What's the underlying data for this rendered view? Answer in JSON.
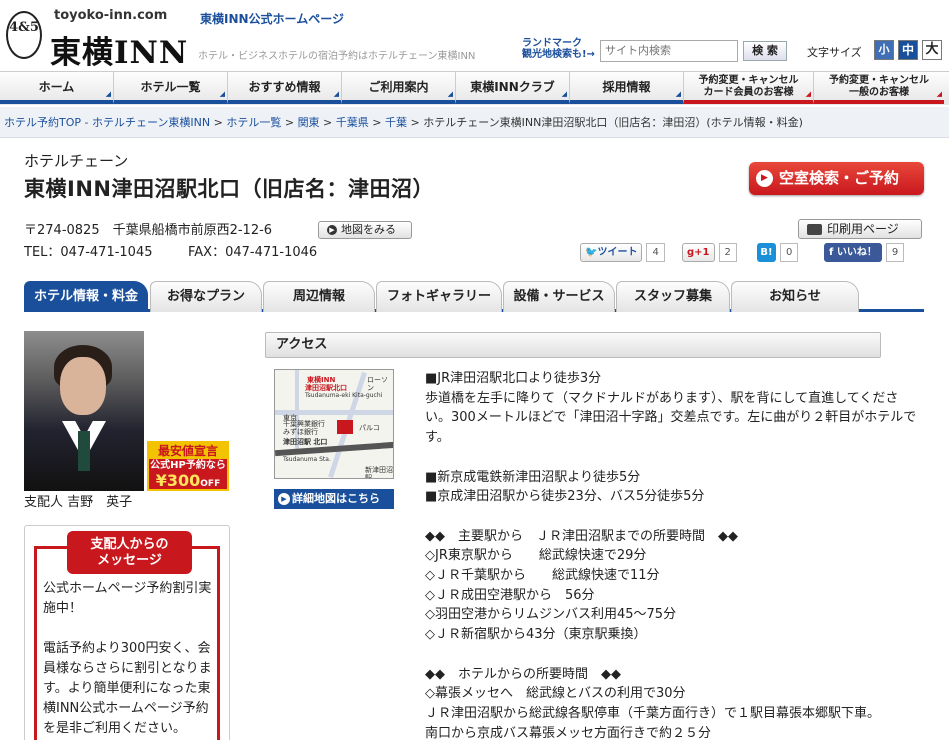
{
  "header": {
    "emblem": "4&5",
    "site_url": "toyoko-inn.com",
    "logo_name": "東横INN",
    "official_link": "東横INN公式ホームページ",
    "tagline": "ホテル・ビジネスホテルの宿泊予約はホテルチェーン東横INN",
    "landmark_line1": "ランドマーク",
    "landmark_line2": "観光地検索も!→",
    "search_placeholder": "サイト内検索",
    "search_button": "検 索",
    "font_size_label": "文字サイズ",
    "font_small": "小",
    "font_medium": "中",
    "font_large": "大"
  },
  "nav": {
    "items": [
      "ホーム",
      "ホテル一覧",
      "おすすめ情報",
      "ご利用案内",
      "東横INNクラブ",
      "採用情報"
    ],
    "member_change_line1": "予約変更・キャンセル",
    "member_change_line2": "カード会員のお客様",
    "general_change_line1": "予約変更・キャンセル",
    "general_change_line2": "一般のお客様",
    "arrow": "◢"
  },
  "breadcrumb": {
    "items": [
      "ホテル予約TOP - ホテルチェーン東横INN",
      "ホテル一覧",
      "関東",
      "千葉県",
      "千葉"
    ],
    "separator": " > ",
    "current": "ホテルチェーン東横INN津田沼駅北口（旧店名：津田沼）(ホテル情報・料金)"
  },
  "hotel": {
    "chain": "ホテルチェーン",
    "name": "東横INN津田沼駅北口（旧店名：津田沼）",
    "reserve_button": "空室検索・ご予約",
    "address": "〒274-0825　千葉県船橋市前原西2-12-6",
    "map_button": "地図をみる",
    "tel": "TEL：047-471-1045",
    "fax": "FAX：047-471-1046",
    "print_button": "印刷用ページ"
  },
  "social": {
    "tweet_label": "ツイート",
    "tweet_count": "4",
    "gplus_label": "g+1",
    "gplus_count": "2",
    "hatena_label": "B!",
    "hatena_count": "0",
    "like_label": "f いいね！",
    "like_count": "9"
  },
  "tabs": [
    "ホテル情報・料金",
    "お得なプラン",
    "周辺情報",
    "フォトギャラリー",
    "設備・サービス",
    "スタッフ募集",
    "お知らせ"
  ],
  "manager": {
    "name": "支配人 吉野　英子",
    "badge_line1": "最安値宣言",
    "badge_line2": "公式HP予約なら",
    "badge_line3": "¥300",
    "badge_line3_suffix": "OFF"
  },
  "message": {
    "title_line1": "支配人からの",
    "title_line2": "メッセージ",
    "paragraph1": "公式ホームページ予約割引実施中！",
    "paragraph2": "電話予約より300円安く、会員様ならさらに割引となります。より簡単便利になった東横INN公式ホームページ予約を是非ご利用ください。"
  },
  "access": {
    "heading": "アクセス",
    "map_detail_button": "詳細地図はこちら",
    "map_labels": {
      "l1": "東横INN",
      "l2": "津田沼駅北口",
      "l3": "Tsudanuma-eki Kita-guchi",
      "l4": "ローソン",
      "l5": "千葉興業銀行",
      "l6": "パルコ",
      "l7": "津田沼駅 北口",
      "l8": "Tsudanuma Sta.",
      "l9": "新津田沼駅",
      "l10": "みずほ銀行",
      "l11": "東京"
    },
    "lines": [
      "■JR津田沼駅北口より徒歩3分",
      "歩道橋を左手に降りて（マクドナルドがあります）、駅を背にして直進してください。300メートルほどで「津田沼十字路」交差点です。左に曲がり２軒目がホテルです。",
      "",
      "■新京成電鉄新津田沼駅より徒歩5分",
      "■京成津田沼駅から徒歩23分、バス5分徒歩5分",
      "",
      "◆◆　主要駅から　ＪＲ津田沼駅までの所要時間　◆◆",
      "◇JR東京駅から　　総武線快速で29分",
      "◇ＪＲ千葉駅から　　総武線快速で11分",
      "◇ＪＲ成田空港駅から　56分",
      "◇羽田空港からリムジンバス利用45～75分",
      "◇ＪＲ新宿駅から43分（東京駅乗換）",
      "",
      "◆◆　ホテルからの所要時間　◆◆",
      "◇幕張メッセへ　総武線とバスの利用で30分",
      "ＪＲ津田沼駅から総武線各駅停車（千葉方面行き）で１駅目幕張本郷駅下車。",
      "南口から京成バス幕張メッセ方面行きで約２５分"
    ]
  },
  "colors": {
    "brand_blue": "#1a4f9c",
    "brand_red": "#c9171e"
  }
}
